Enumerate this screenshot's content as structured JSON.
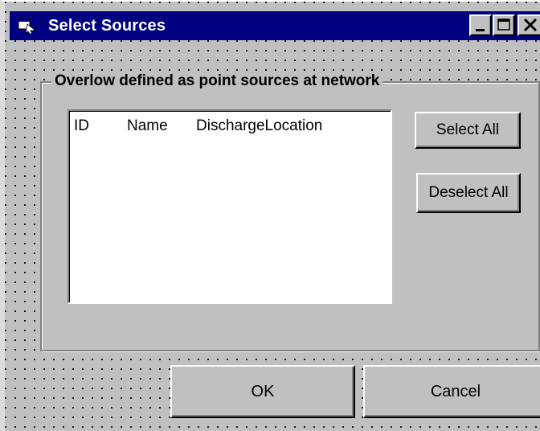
{
  "window": {
    "title": "Select Sources",
    "icon": "form-icon",
    "controls": {
      "minimize": "minimize-icon",
      "maximize": "maximize-icon",
      "close": "close-icon"
    }
  },
  "group": {
    "caption": "Overlow defined as point sources at network"
  },
  "list": {
    "columns": [
      "ID",
      "Name",
      "DischargeLocation"
    ],
    "rows": []
  },
  "buttons": {
    "select_all": "Select All",
    "deselect_all": "Deselect All",
    "ok": "OK",
    "cancel": "Cancel"
  },
  "colors": {
    "titlebar": "#000080",
    "face": "#c0c0c0",
    "list_bg": "#ffffff"
  }
}
